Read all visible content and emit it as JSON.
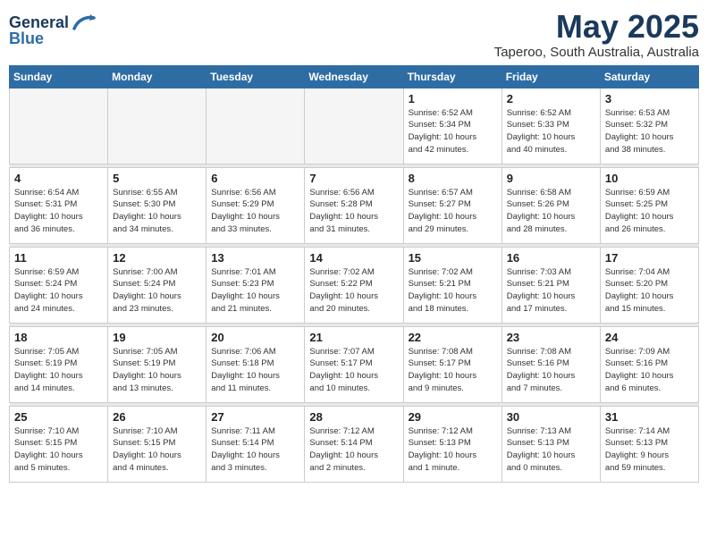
{
  "header": {
    "logo_line1": "General",
    "logo_line2": "Blue",
    "month_year": "May 2025",
    "location": "Taperoo, South Australia, Australia"
  },
  "weekdays": [
    "Sunday",
    "Monday",
    "Tuesday",
    "Wednesday",
    "Thursday",
    "Friday",
    "Saturday"
  ],
  "weeks": [
    [
      {
        "day": "",
        "info": ""
      },
      {
        "day": "",
        "info": ""
      },
      {
        "day": "",
        "info": ""
      },
      {
        "day": "",
        "info": ""
      },
      {
        "day": "1",
        "info": "Sunrise: 6:52 AM\nSunset: 5:34 PM\nDaylight: 10 hours\nand 42 minutes."
      },
      {
        "day": "2",
        "info": "Sunrise: 6:52 AM\nSunset: 5:33 PM\nDaylight: 10 hours\nand 40 minutes."
      },
      {
        "day": "3",
        "info": "Sunrise: 6:53 AM\nSunset: 5:32 PM\nDaylight: 10 hours\nand 38 minutes."
      }
    ],
    [
      {
        "day": "4",
        "info": "Sunrise: 6:54 AM\nSunset: 5:31 PM\nDaylight: 10 hours\nand 36 minutes."
      },
      {
        "day": "5",
        "info": "Sunrise: 6:55 AM\nSunset: 5:30 PM\nDaylight: 10 hours\nand 34 minutes."
      },
      {
        "day": "6",
        "info": "Sunrise: 6:56 AM\nSunset: 5:29 PM\nDaylight: 10 hours\nand 33 minutes."
      },
      {
        "day": "7",
        "info": "Sunrise: 6:56 AM\nSunset: 5:28 PM\nDaylight: 10 hours\nand 31 minutes."
      },
      {
        "day": "8",
        "info": "Sunrise: 6:57 AM\nSunset: 5:27 PM\nDaylight: 10 hours\nand 29 minutes."
      },
      {
        "day": "9",
        "info": "Sunrise: 6:58 AM\nSunset: 5:26 PM\nDaylight: 10 hours\nand 28 minutes."
      },
      {
        "day": "10",
        "info": "Sunrise: 6:59 AM\nSunset: 5:25 PM\nDaylight: 10 hours\nand 26 minutes."
      }
    ],
    [
      {
        "day": "11",
        "info": "Sunrise: 6:59 AM\nSunset: 5:24 PM\nDaylight: 10 hours\nand 24 minutes."
      },
      {
        "day": "12",
        "info": "Sunrise: 7:00 AM\nSunset: 5:24 PM\nDaylight: 10 hours\nand 23 minutes."
      },
      {
        "day": "13",
        "info": "Sunrise: 7:01 AM\nSunset: 5:23 PM\nDaylight: 10 hours\nand 21 minutes."
      },
      {
        "day": "14",
        "info": "Sunrise: 7:02 AM\nSunset: 5:22 PM\nDaylight: 10 hours\nand 20 minutes."
      },
      {
        "day": "15",
        "info": "Sunrise: 7:02 AM\nSunset: 5:21 PM\nDaylight: 10 hours\nand 18 minutes."
      },
      {
        "day": "16",
        "info": "Sunrise: 7:03 AM\nSunset: 5:21 PM\nDaylight: 10 hours\nand 17 minutes."
      },
      {
        "day": "17",
        "info": "Sunrise: 7:04 AM\nSunset: 5:20 PM\nDaylight: 10 hours\nand 15 minutes."
      }
    ],
    [
      {
        "day": "18",
        "info": "Sunrise: 7:05 AM\nSunset: 5:19 PM\nDaylight: 10 hours\nand 14 minutes."
      },
      {
        "day": "19",
        "info": "Sunrise: 7:05 AM\nSunset: 5:19 PM\nDaylight: 10 hours\nand 13 minutes."
      },
      {
        "day": "20",
        "info": "Sunrise: 7:06 AM\nSunset: 5:18 PM\nDaylight: 10 hours\nand 11 minutes."
      },
      {
        "day": "21",
        "info": "Sunrise: 7:07 AM\nSunset: 5:17 PM\nDaylight: 10 hours\nand 10 minutes."
      },
      {
        "day": "22",
        "info": "Sunrise: 7:08 AM\nSunset: 5:17 PM\nDaylight: 10 hours\nand 9 minutes."
      },
      {
        "day": "23",
        "info": "Sunrise: 7:08 AM\nSunset: 5:16 PM\nDaylight: 10 hours\nand 7 minutes."
      },
      {
        "day": "24",
        "info": "Sunrise: 7:09 AM\nSunset: 5:16 PM\nDaylight: 10 hours\nand 6 minutes."
      }
    ],
    [
      {
        "day": "25",
        "info": "Sunrise: 7:10 AM\nSunset: 5:15 PM\nDaylight: 10 hours\nand 5 minutes."
      },
      {
        "day": "26",
        "info": "Sunrise: 7:10 AM\nSunset: 5:15 PM\nDaylight: 10 hours\nand 4 minutes."
      },
      {
        "day": "27",
        "info": "Sunrise: 7:11 AM\nSunset: 5:14 PM\nDaylight: 10 hours\nand 3 minutes."
      },
      {
        "day": "28",
        "info": "Sunrise: 7:12 AM\nSunset: 5:14 PM\nDaylight: 10 hours\nand 2 minutes."
      },
      {
        "day": "29",
        "info": "Sunrise: 7:12 AM\nSunset: 5:13 PM\nDaylight: 10 hours\nand 1 minute."
      },
      {
        "day": "30",
        "info": "Sunrise: 7:13 AM\nSunset: 5:13 PM\nDaylight: 10 hours\nand 0 minutes."
      },
      {
        "day": "31",
        "info": "Sunrise: 7:14 AM\nSunset: 5:13 PM\nDaylight: 9 hours\nand 59 minutes."
      }
    ]
  ]
}
